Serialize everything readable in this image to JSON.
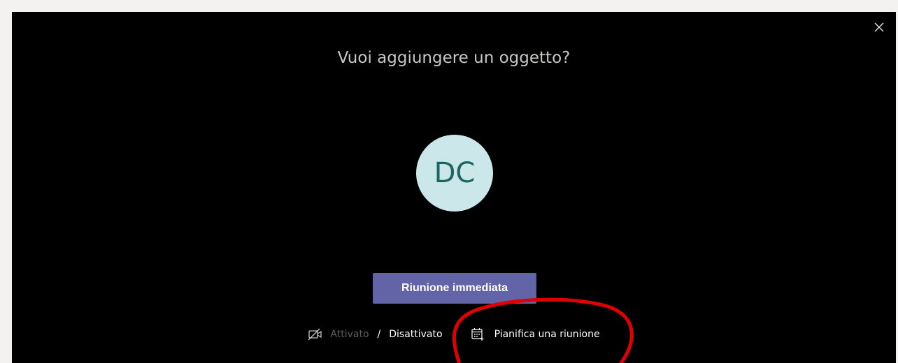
{
  "dialog": {
    "title": "Vuoi aggiungere un oggetto?",
    "close_icon": "close-icon",
    "avatar_initials": "DC",
    "meet_now_label": "Riunione immediata",
    "video": {
      "icon": "video-off-icon",
      "on_label": "Attivato",
      "separator": "/",
      "off_label": "Disattivato"
    },
    "schedule": {
      "icon": "calendar-add-icon",
      "label": "Pianifica una riunione"
    }
  },
  "colors": {
    "dialog_bg": "#000000",
    "primary": "#6264a7",
    "avatar_bg": "#cbe7ea",
    "avatar_text": "#1d6560",
    "annotation": "#e00000"
  }
}
